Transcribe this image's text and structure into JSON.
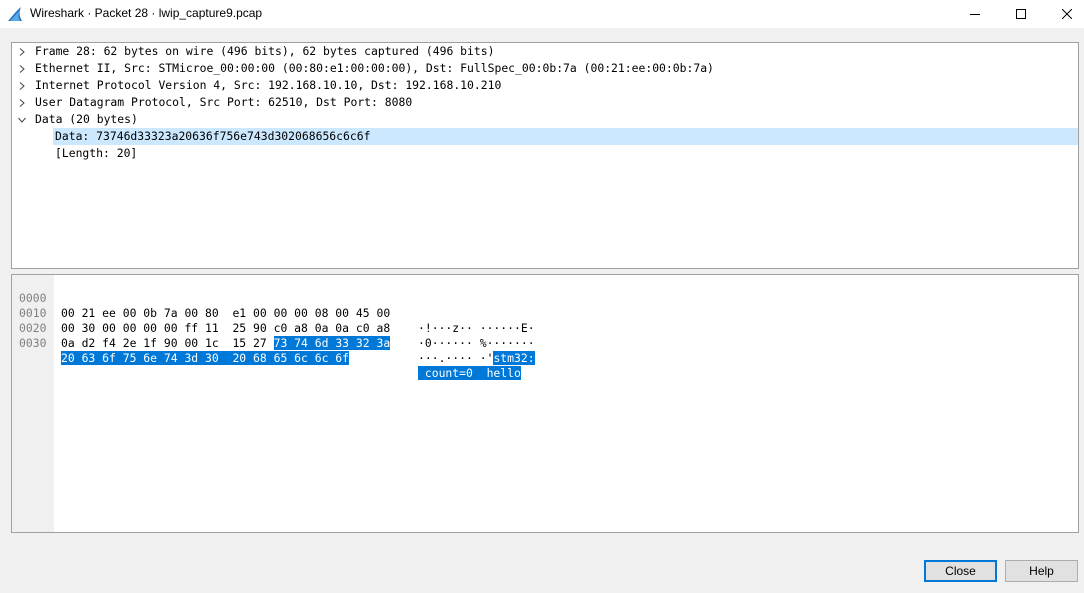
{
  "window": {
    "title": "Wireshark · Packet 28 · lwip_capture9.pcap",
    "app_icon": "wireshark-fin-icon",
    "controls": [
      "minimize-icon",
      "maximize-icon",
      "close-icon"
    ]
  },
  "tree": {
    "rows": [
      {
        "label": "Frame 28: 62 bytes on wire (496 bits), 62 bytes captured (496 bits)",
        "expanded": false
      },
      {
        "label": "Ethernet II, Src: STMicroe_00:00:00 (00:80:e1:00:00:00), Dst: FullSpec_00:0b:7a (00:21:ee:00:0b:7a)",
        "expanded": false
      },
      {
        "label": "Internet Protocol Version 4, Src: 192.168.10.10, Dst: 192.168.10.210",
        "expanded": false
      },
      {
        "label": "User Datagram Protocol, Src Port: 62510, Dst Port: 8080",
        "expanded": false
      },
      {
        "label": "Data (20 bytes)",
        "expanded": true
      }
    ],
    "children": [
      {
        "label": "Data: 73746d33323a20636f756e743d302068656c6c6f",
        "selected": true
      },
      {
        "label": "[Length: 20]",
        "selected": false
      }
    ]
  },
  "bytes": {
    "lines": [
      {
        "offset": "0000",
        "hex_plain": "00 21 ee 00 0b 7a 00 80  e1 00 00 00 08 00 45 00",
        "hex_hl": "",
        "ascii_plain": "·!···z·· ······E·",
        "ascii_hl": ""
      },
      {
        "offset": "0010",
        "hex_plain": "00 30 00 00 00 00 ff 11  25 90 c0 a8 0a 0a c0 a8",
        "hex_hl": "",
        "ascii_plain": "·0······ %·······",
        "ascii_hl": ""
      },
      {
        "offset": "0020",
        "hex_plain": "0a d2 f4 2e 1f 90 00 1c  15 27 ",
        "hex_hl": "73 74 6d 33 32 3a",
        "ascii_plain": "···.···· ·'",
        "ascii_hl": "stm32:"
      },
      {
        "offset": "0030",
        "hex_plain": "",
        "hex_hl": "20 63 6f 75 6e 74 3d 30  20 68 65 6c 6c 6f",
        "ascii_plain": "",
        "ascii_hl": " count=0  hello"
      }
    ]
  },
  "buttons": {
    "close_label": "Close",
    "help_label": "Help"
  }
}
